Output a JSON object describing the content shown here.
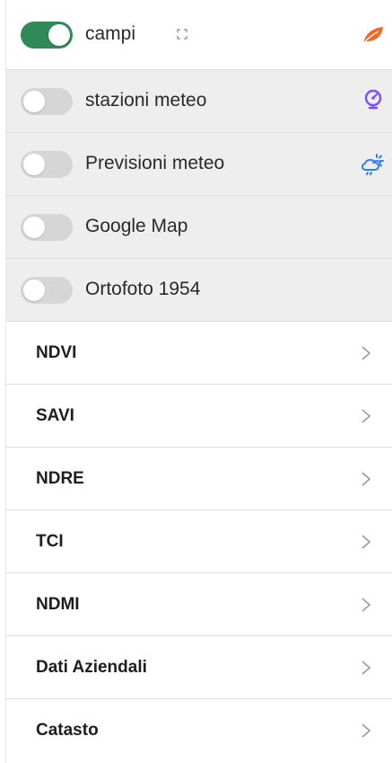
{
  "layers": [
    {
      "id": "campi",
      "label": "campi",
      "enabled": true,
      "icon": "leaf-icon",
      "icon_color": "#f26a21",
      "has_expand": true
    },
    {
      "id": "stazioni",
      "label": "stazioni meteo",
      "enabled": false,
      "icon": "gauge-icon",
      "icon_color": "#7b4dff"
    },
    {
      "id": "previsioni",
      "label": "Previsioni meteo",
      "enabled": false,
      "icon": "sun-cloud-icon",
      "icon_color": "#2f80ed"
    },
    {
      "id": "google",
      "label": "Google Map",
      "enabled": false
    },
    {
      "id": "ortofoto",
      "label": "Ortofoto 1954",
      "enabled": false
    }
  ],
  "indices": [
    {
      "label": "NDVI"
    },
    {
      "label": "SAVI"
    },
    {
      "label": "NDRE"
    },
    {
      "label": "TCI"
    },
    {
      "label": "NDMI"
    },
    {
      "label": "Dati Aziendali"
    },
    {
      "label": "Catasto"
    }
  ],
  "colors": {
    "toggle_on": "#2e8b57",
    "toggle_off": "#d6d6d6",
    "row_grey": "#eeeeee"
  }
}
